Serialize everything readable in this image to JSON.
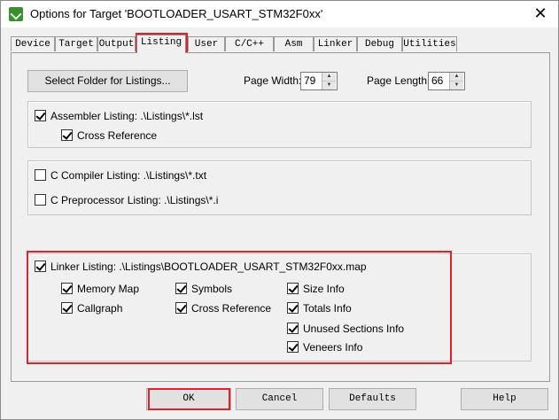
{
  "window": {
    "title": "Options for Target 'BOOTLOADER_USART_STM32F0xx'",
    "close_glyph": "✕"
  },
  "tabs": [
    {
      "label": "Device"
    },
    {
      "label": "Target"
    },
    {
      "label": "Output"
    },
    {
      "label": "Listing",
      "active": true
    },
    {
      "label": "User"
    },
    {
      "label": "C/C++"
    },
    {
      "label": "Asm"
    },
    {
      "label": "Linker"
    },
    {
      "label": "Debug"
    },
    {
      "label": "Utilities"
    }
  ],
  "listing": {
    "select_folder_label": "Select Folder for Listings...",
    "page_width_label": "Page Width:",
    "page_width_value": "79",
    "page_length_label": "Page Length:",
    "page_length_value": "66",
    "assembler": {
      "label": "Assembler Listing:  .\\Listings\\*.lst",
      "checked": true,
      "cross_reference": {
        "label": "Cross Reference",
        "checked": true
      }
    },
    "c_compiler": {
      "label": "C Compiler Listing:  .\\Listings\\*.txt",
      "checked": false
    },
    "c_preprocessor": {
      "label": "C Preprocessor Listing:  .\\Listings\\*.i",
      "checked": false
    },
    "linker": {
      "label": "Linker Listing:  .\\Listings\\BOOTLOADER_USART_STM32F0xx.map",
      "checked": true,
      "options": {
        "memory_map": {
          "label": "Memory Map",
          "checked": true
        },
        "symbols": {
          "label": "Symbols",
          "checked": true
        },
        "size_info": {
          "label": "Size Info",
          "checked": true
        },
        "callgraph": {
          "label": "Callgraph",
          "checked": true
        },
        "cross_reference": {
          "label": "Cross Reference",
          "checked": true
        },
        "totals_info": {
          "label": "Totals Info",
          "checked": true
        },
        "unused_sections_info": {
          "label": "Unused Sections Info",
          "checked": true
        },
        "veneers_info": {
          "label": "Veneers Info",
          "checked": true
        }
      }
    }
  },
  "buttons": {
    "ok": "OK",
    "cancel": "Cancel",
    "defaults": "Defaults",
    "help": "Help"
  },
  "colors": {
    "highlight": "#e0202a",
    "dialog_bg": "#f0f0f0"
  }
}
